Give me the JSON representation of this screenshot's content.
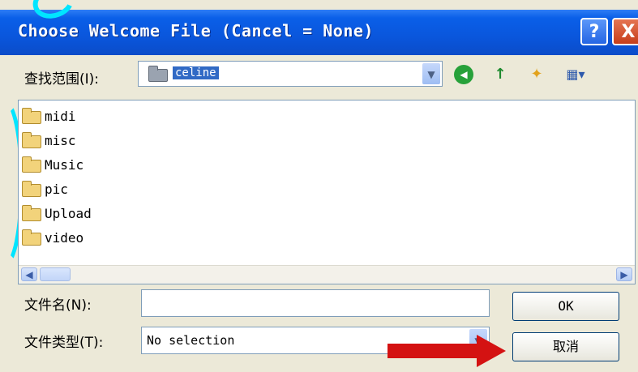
{
  "window": {
    "title": "Choose Welcome File (Cancel = None)",
    "help_button": "?",
    "close_button": "X"
  },
  "lookin": {
    "label": "查找范围(I):",
    "selected_folder": "celine",
    "dropdown_arrow": "▼"
  },
  "toolbar": {
    "icons": [
      "back-icon",
      "up-folder-icon",
      "new-folder-icon",
      "view-menu-icon"
    ],
    "back": "◀",
    "up": "↑",
    "new_folder": "✦",
    "view": "▦▾"
  },
  "files": [
    {
      "name": "midi",
      "icon": "folder-icon"
    },
    {
      "name": "misc",
      "icon": "folder-icon"
    },
    {
      "name": "Music",
      "icon": "folder-icon"
    },
    {
      "name": "pic",
      "icon": "folder-icon"
    },
    {
      "name": "Upload",
      "icon": "folder-icon"
    },
    {
      "name": "video",
      "icon": "folder-icon"
    }
  ],
  "scrollbar": {
    "left": "◀",
    "right": "▶"
  },
  "filename": {
    "label": "文件名(N):",
    "value": ""
  },
  "filetype": {
    "label": "文件类型(T):",
    "value": "No selection",
    "dropdown_arrow": "▼"
  },
  "buttons": {
    "ok": "OK",
    "cancel": "取消"
  },
  "colors": {
    "accent": "#0a56dc",
    "arrow": "#d41212",
    "decor": "#00e5ff"
  }
}
